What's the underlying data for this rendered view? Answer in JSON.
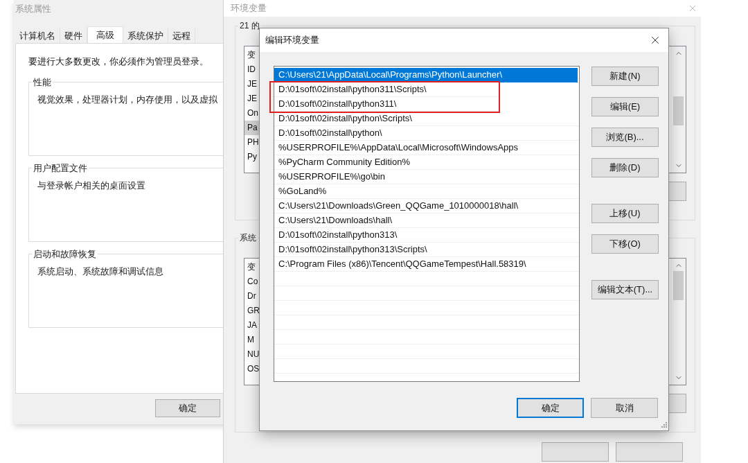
{
  "system_properties": {
    "title": "系统属性",
    "tabs": [
      {
        "label": "计算机名",
        "selected": false
      },
      {
        "label": "硬件",
        "selected": false
      },
      {
        "label": "高级",
        "selected": true
      },
      {
        "label": "系统保护",
        "selected": false
      },
      {
        "label": "远程",
        "selected": false
      }
    ],
    "notice": "要进行大多数更改，你必须作为管理员登录。",
    "groups": [
      {
        "title": "性能",
        "text": "视觉效果，处理器计划，内存使用，以及虚拟"
      },
      {
        "title": "用户配置文件",
        "text": "与登录帐户相关的桌面设置"
      },
      {
        "title": "启动和故障恢复",
        "text": "系统启动、系统故障和调试信息"
      }
    ],
    "buttons": [
      "确定"
    ]
  },
  "environment_variables": {
    "title": "环境变量",
    "lists": [
      {
        "title": "21 的",
        "header": "变",
        "rows": [
          {
            "text": "ID",
            "selected": false
          },
          {
            "text": "JE",
            "selected": false
          },
          {
            "text": "JE",
            "selected": false
          },
          {
            "text": "On",
            "selected": false
          },
          {
            "text": "Pa",
            "selected": true
          },
          {
            "text": "PH",
            "selected": false
          },
          {
            "text": "Py",
            "selected": false
          }
        ]
      },
      {
        "title": "系统",
        "header": "变",
        "rows": [
          {
            "text": "Co",
            "selected": false
          },
          {
            "text": "Dr",
            "selected": false
          },
          {
            "text": "GR",
            "selected": false
          },
          {
            "text": "JA",
            "selected": false
          },
          {
            "text": "M",
            "selected": false
          },
          {
            "text": "NU",
            "selected": false
          },
          {
            "text": "OS",
            "selected": false
          }
        ]
      }
    ]
  },
  "edit_dialog": {
    "title": "编辑环境变量",
    "entries": [
      {
        "text": "C:\\Users\\21\\AppData\\Local\\Programs\\Python\\Launcher\\",
        "selected": true,
        "highlighted": false
      },
      {
        "text": "D:\\01soft\\02install\\python311\\Scripts\\",
        "selected": false,
        "highlighted": true
      },
      {
        "text": "D:\\01soft\\02install\\python311\\",
        "selected": false,
        "highlighted": true
      },
      {
        "text": "D:\\01soft\\02install\\python\\Scripts\\",
        "selected": false,
        "highlighted": false
      },
      {
        "text": "D:\\01soft\\02install\\python\\",
        "selected": false,
        "highlighted": false
      },
      {
        "text": "%USERPROFILE%\\AppData\\Local\\Microsoft\\WindowsApps",
        "selected": false,
        "highlighted": false
      },
      {
        "text": "%PyCharm Community Edition%",
        "selected": false,
        "highlighted": false
      },
      {
        "text": "%USERPROFILE%\\go\\bin",
        "selected": false,
        "highlighted": false
      },
      {
        "text": "%GoLand%",
        "selected": false,
        "highlighted": false
      },
      {
        "text": "C:\\Users\\21\\Downloads\\Green_QQGame_1010000018\\hall\\",
        "selected": false,
        "highlighted": false
      },
      {
        "text": "C:\\Users\\21\\Downloads\\hall\\",
        "selected": false,
        "highlighted": false
      },
      {
        "text": "D:\\01soft\\02install\\python313\\",
        "selected": false,
        "highlighted": false
      },
      {
        "text": "D:\\01soft\\02install\\python313\\Scripts\\",
        "selected": false,
        "highlighted": false
      },
      {
        "text": "C:\\Program Files (x86)\\Tencent\\QQGameTempest\\Hall.58319\\",
        "selected": false,
        "highlighted": false
      }
    ],
    "side_button_groups": [
      [
        "新建(N)",
        "编辑(E)",
        "浏览(B)...",
        "删除(D)"
      ],
      [
        "上移(U)",
        "下移(O)"
      ],
      [
        "编辑文本(T)..."
      ]
    ],
    "footer_buttons": [
      {
        "label": "确定",
        "default": true
      },
      {
        "label": "取消",
        "default": false
      }
    ]
  }
}
